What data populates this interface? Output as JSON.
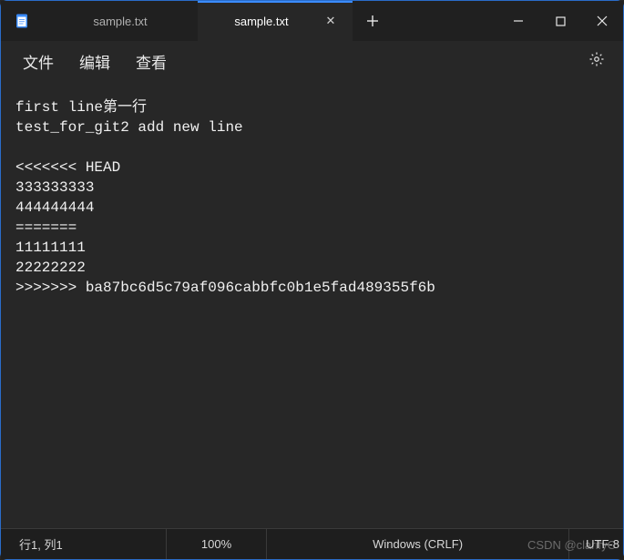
{
  "tabs": [
    {
      "label": "sample.txt",
      "active": false
    },
    {
      "label": "sample.txt",
      "active": true
    }
  ],
  "menu": {
    "file": "文件",
    "edit": "编辑",
    "view": "查看"
  },
  "editor_lines": [
    "first line第一行",
    "test_for_git2 add new line",
    "",
    "<<<<<<< HEAD",
    "333333333",
    "444444444",
    "=======",
    "11111111",
    "22222222",
    ">>>>>>> ba87bc6d5c79af096cabbfc0b1e5fad489355f6b"
  ],
  "status": {
    "position": "行1, 列1",
    "zoom": "100%",
    "eol": "Windows (CRLF)",
    "encoding": "UTF-8"
  },
  "watermark": "CSDN @clarifyC"
}
